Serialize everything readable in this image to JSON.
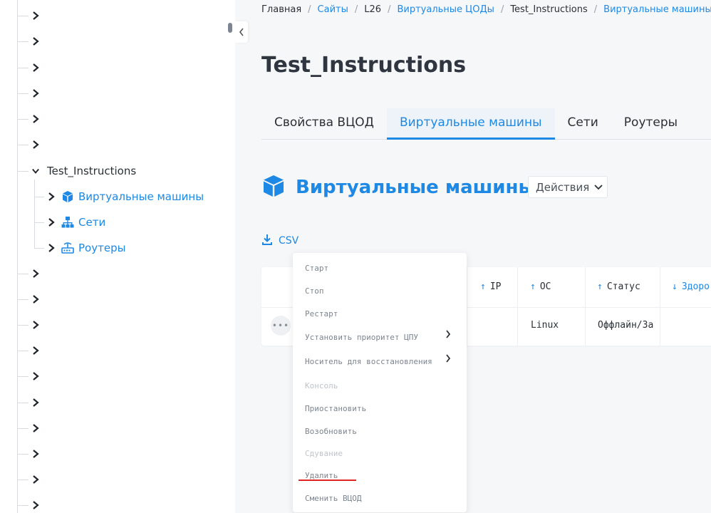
{
  "breadcrumb": {
    "home": "Главная",
    "sites": "Сайты",
    "l26": "L26",
    "vcod": "Виртуальные ЦОДы",
    "test": "Test_Instructions",
    "vms": "Виртуальные машины",
    "separator": "/"
  },
  "page": {
    "title": "Test_Instructions"
  },
  "tabs": [
    {
      "label": "Свойства ВЦОД"
    },
    {
      "label": "Виртуальные машины"
    },
    {
      "label": "Сети"
    },
    {
      "label": "Роутеры"
    }
  ],
  "section": {
    "title": "Виртуальные машины",
    "icon": "cube-icon"
  },
  "actions": {
    "label": "Действия"
  },
  "csv": {
    "label": "CSV"
  },
  "table": {
    "columns": [
      {
        "label": "IP",
        "sort": "↑"
      },
      {
        "label": "ОС",
        "sort": "↑"
      },
      {
        "label": "Статус",
        "sort": "↑"
      },
      {
        "label": "Здоро",
        "sort": "↓"
      }
    ],
    "row": {
      "os": "Linux",
      "status": "Оффлайн/За",
      "menu": "•••"
    }
  },
  "context_menu": {
    "items": [
      {
        "label": "Старт"
      },
      {
        "label": "Стоп"
      },
      {
        "label": "Рестарт"
      },
      {
        "label": "Установить приоритет ЦПУ"
      },
      {
        "label": "Носитель для восстановления"
      },
      {
        "label": "Консоль"
      },
      {
        "label": "Приостановить"
      },
      {
        "label": "Возобновить"
      },
      {
        "label": "Сдувание"
      },
      {
        "label": "Удалить"
      },
      {
        "label": "Сменить ВЦОД"
      }
    ],
    "submenu_arrow": ">"
  },
  "tree": {
    "expanded_node": "Test_Instructions",
    "children": [
      {
        "label": "Виртуальные машины",
        "icon": "cube-icon"
      },
      {
        "label": "Сети",
        "icon": "network-icon"
      },
      {
        "label": "Роутеры",
        "icon": "router-icon"
      }
    ]
  },
  "colors": {
    "accent": "#1e88e5",
    "highlight": "#e02424"
  }
}
